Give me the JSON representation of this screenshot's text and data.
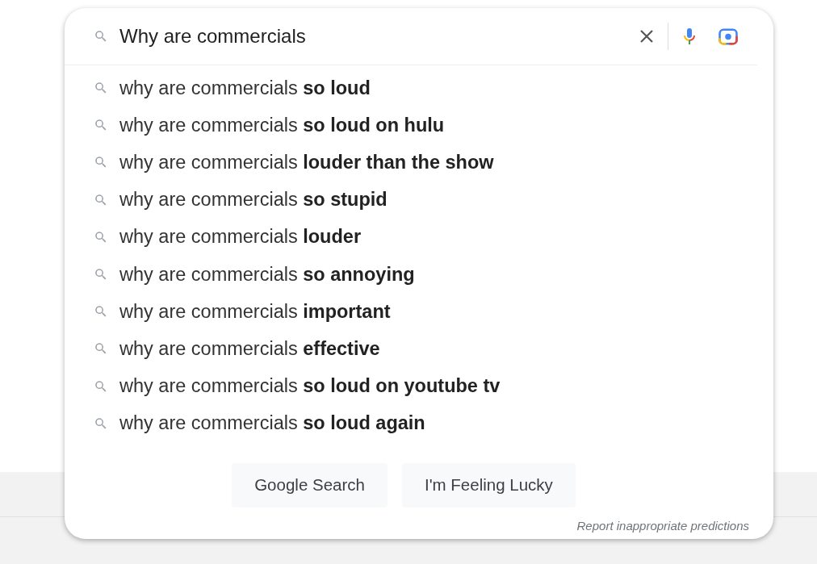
{
  "search": {
    "value": "Why are commercials"
  },
  "suggestions": [
    {
      "text": "why are commercials **so loud**"
    },
    {
      "text": "why are commercials **so loud on hulu**"
    },
    {
      "text": "why are commercials **louder than the show**"
    },
    {
      "text": "why are commercials **so stupid**"
    },
    {
      "text": "why are commercials **louder**"
    },
    {
      "text": "why are commercials **so annoying**"
    },
    {
      "text": "why are commercials **important**"
    },
    {
      "text": "why are commercials **effective**"
    },
    {
      "text": "why are commercials **so loud on youtube tv**"
    },
    {
      "text": "why are commercials **so loud again**"
    }
  ],
  "buttons": [
    "Google Search",
    "I'm Feeling Lucky"
  ],
  "report_link": "Report inappropriate predictions"
}
